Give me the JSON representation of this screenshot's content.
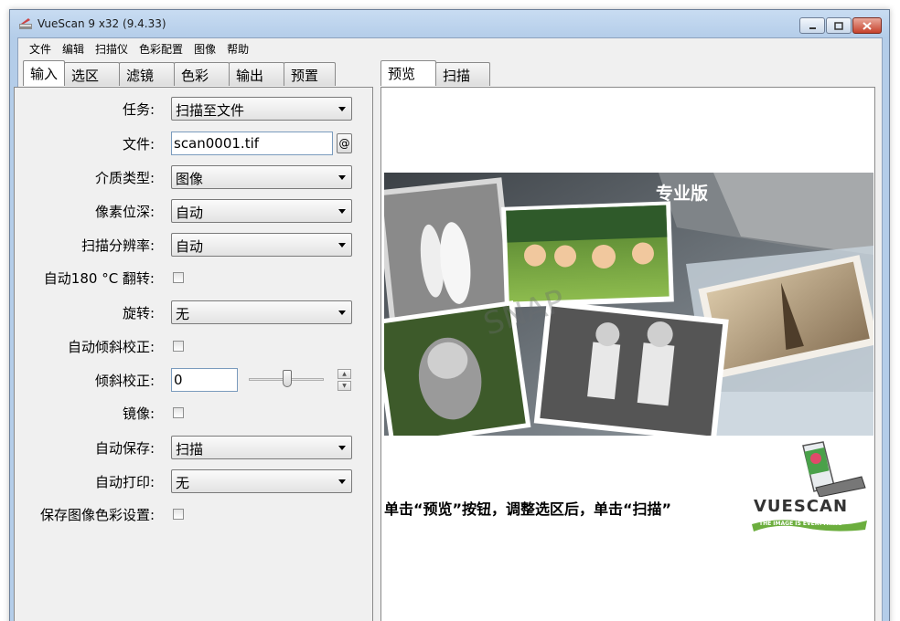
{
  "window": {
    "title": "VueScan 9 x32 (9.4.33)"
  },
  "menu": [
    "文件",
    "编辑",
    "扫描仪",
    "色彩配置",
    "图像",
    "帮助"
  ],
  "left_tabs": [
    "输入",
    "选区",
    "滤镜",
    "色彩",
    "输出",
    "预置"
  ],
  "right_tabs": [
    "预览",
    "扫描"
  ],
  "form": {
    "task": {
      "label": "任务:",
      "value": "扫描至文件"
    },
    "file": {
      "label": "文件:",
      "value": "scan0001.tif",
      "button": "@"
    },
    "media_type": {
      "label": "介质类型:",
      "value": "图像"
    },
    "bit_depth": {
      "label": "像素位深:",
      "value": "自动"
    },
    "resolution": {
      "label": "扫描分辨率:",
      "value": "自动"
    },
    "auto_rotate": {
      "label": "自动180 °C 翻转:"
    },
    "rotate": {
      "label": "旋转:",
      "value": "无"
    },
    "auto_deskew": {
      "label": "自动倾斜校正:"
    },
    "deskew": {
      "label": "倾斜校正:",
      "value": "0"
    },
    "mirror": {
      "label": "镜像:"
    },
    "auto_save": {
      "label": "自动保存:",
      "value": "扫描"
    },
    "auto_print": {
      "label": "自动打印:",
      "value": "无"
    },
    "save_color": {
      "label": "保存图像色彩设置:"
    }
  },
  "preview": {
    "edition": "专业版",
    "hint": "单击“预览”按钮，调整选区后，单击“扫描”",
    "logo_text": "VUESCAN",
    "logo_tagline": "THE IMAGE IS EVERYTHING"
  }
}
